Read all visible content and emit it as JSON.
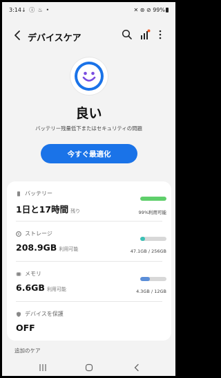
{
  "status_bar": {
    "time": "3:14",
    "left_icons": "↓ ⓘ ♨ •",
    "right_icons": "✕ ⊛ ⊘",
    "battery": "99%"
  },
  "header": {
    "title": "デバイスケア",
    "icons": [
      "back-arrow-icon",
      "search-icon",
      "signal-bars-icon",
      "more-vert-icon"
    ]
  },
  "summary": {
    "state": "良い",
    "description": "バッテリー残量低下またはセキュリティの問題",
    "optimize_label": "今すぐ最適化"
  },
  "items": [
    {
      "label": "バッテリー",
      "value": "1日と17時間",
      "sub": "残り",
      "bar_fraction": 0.99,
      "bar_text": "99%利用可能",
      "color": "#5fcf6b"
    },
    {
      "label": "ストレージ",
      "value": "208.9GB",
      "sub": "利用可能",
      "bar_fraction": 0.18,
      "bar_text": "47.1GB / 256GB",
      "color": "#3cc0b5"
    },
    {
      "label": "メモリ",
      "value": "6.6GB",
      "sub": "利用可能",
      "bar_fraction": 0.36,
      "bar_text": "4.3GB / 12GB",
      "color": "#5b8ed8"
    },
    {
      "label": "デバイスを保護",
      "value": "OFF"
    }
  ],
  "section_title": "追加のケア",
  "accent": "#1a73e8"
}
